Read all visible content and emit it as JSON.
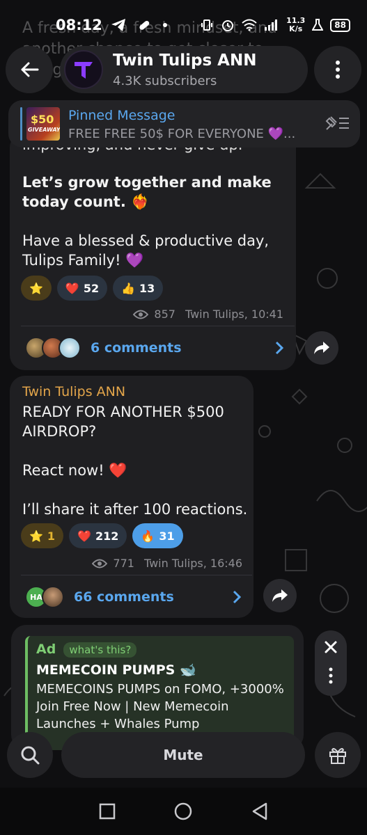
{
  "status": {
    "time": "08:12",
    "net_speed_value": "11.3",
    "net_speed_unit": "K/s",
    "battery": "88"
  },
  "ghost_text": "A fresh day, a fresh mindset, and another chance to get closer to our goals.",
  "header": {
    "channel_name": "Twin Tulips ANN",
    "subscribers": "4.3K subscribers"
  },
  "pinned": {
    "title": "Pinned Message",
    "text": "FREE FREE 50$ FOR EVERYONE 💜...",
    "thumb_amount": "$50",
    "thumb_label": "GIVEAWAY"
  },
  "messages": [
    {
      "partial_top": "improving, and never give up.",
      "bold_line": "Let’s grow together and make today count. ❤️‍🔥",
      "body": "Have a blessed & productive day, Tulips Family! 💜",
      "reactions": [
        {
          "emoji": "⭐",
          "count": ""
        },
        {
          "emoji": "❤️",
          "count": "52"
        },
        {
          "emoji": "👍",
          "count": "13"
        }
      ],
      "views": "857",
      "author_time": "Twin Tulips, 10:41",
      "comments": "6 comments"
    },
    {
      "author": "Twin Tulips ANN",
      "line1": "READY FOR ANOTHER $500 AIRDROP?",
      "line2": "React now! ❤️",
      "line3": "I’ll share it after 100 reactions.",
      "reactions": [
        {
          "emoji": "⭐",
          "count": "1"
        },
        {
          "emoji": "❤️",
          "count": "212"
        },
        {
          "emoji": "🔥",
          "count": "31"
        }
      ],
      "views": "771",
      "author_time": "Twin Tulips, 16:46",
      "comments": "66 comments",
      "avatar_initials": "HA"
    }
  ],
  "ad": {
    "label": "Ad",
    "whats_this": "what's this?",
    "title": "MEMECOIN PUMPS 🐋",
    "body": "MEMECOINS PUMPS on FOMO, +3000% Join Free Now | New Memecoin Launches + Whales Pump"
  },
  "bottom": {
    "mute_label": "Mute"
  },
  "colors": {
    "accent": "#5aa7ee",
    "ad_green": "#7fce74",
    "bubble": "#1f1f22"
  }
}
